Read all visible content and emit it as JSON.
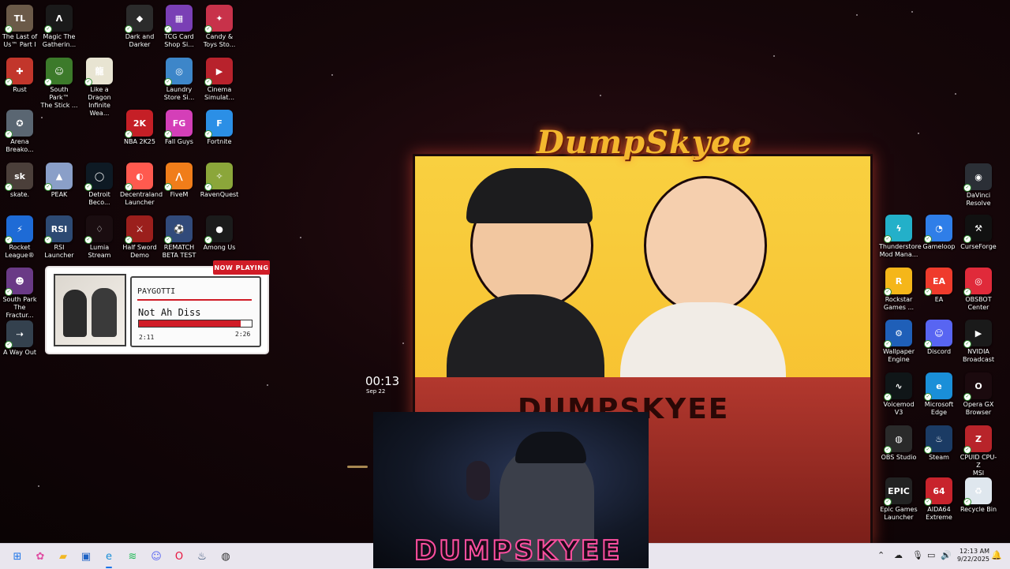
{
  "desktop_icons_left": [
    {
      "label": "The Last of\nUs™ Part I",
      "icon": "last-of-us-icon",
      "color": "#6b5a48",
      "glyph": "TL"
    },
    {
      "label": "Magic The\nGatherin...",
      "icon": "mtg-arena-icon",
      "color": "#1a1a1a",
      "glyph": "Λ"
    },
    {
      "label": "Dark and\nDarker",
      "icon": "dark-and-darker-icon",
      "color": "#2b2b2b",
      "glyph": "◆"
    },
    {
      "label": "TCG Card\nShop Si...",
      "icon": "tcg-card-shop-icon",
      "color": "#7a3fb5",
      "glyph": "▦"
    },
    {
      "label": "Candy &\nToys Sto...",
      "icon": "candy-toys-store-icon",
      "color": "#c8324a",
      "glyph": "✦"
    },
    {
      "label": "Rust",
      "icon": "rust-icon",
      "color": "#c2362b",
      "glyph": "✚"
    },
    {
      "label": "South Park™\nThe Stick ...",
      "icon": "south-park-stick-icon",
      "color": "#3c7a2a",
      "glyph": "☺"
    },
    {
      "label": "Like a Dragon\nInfinite Wea...",
      "icon": "like-a-dragon-icon",
      "color": "#e8e4d2",
      "glyph": "龍"
    },
    {
      "label": "Laundry\nStore Si...",
      "icon": "laundry-store-icon",
      "color": "#3d86c9",
      "glyph": "◎"
    },
    {
      "label": "Cinema\nSimulat...",
      "icon": "cinema-simulator-icon",
      "color": "#b8222c",
      "glyph": "▶"
    },
    {
      "label": "Arena\nBreako...",
      "icon": "arena-breakout-icon",
      "color": "#5a6672",
      "glyph": "✪"
    },
    {
      "label": "NBA 2K25",
      "icon": "nba-2k25-icon",
      "color": "#c51f26",
      "glyph": "2K"
    },
    {
      "label": "Fall Guys",
      "icon": "fall-guys-icon",
      "color": "#d43fb8",
      "glyph": "FG"
    },
    {
      "label": "Fortnite",
      "icon": "fortnite-icon",
      "color": "#2b8fe6",
      "glyph": "F"
    },
    {
      "label": "skate.",
      "icon": "skate-icon",
      "color": "#4b3f3a",
      "glyph": "sk"
    },
    {
      "label": "PEAK",
      "icon": "peak-icon",
      "color": "#8a9fc8",
      "glyph": "▲"
    },
    {
      "label": "Detroit\nBeco...",
      "icon": "detroit-become-human-icon",
      "color": "#0e1a24",
      "glyph": "◯"
    },
    {
      "label": "Decentraland\nLauncher",
      "icon": "decentraland-icon",
      "color": "#ff5a4f",
      "glyph": "◐"
    },
    {
      "label": "FiveM",
      "icon": "fivem-icon",
      "color": "#f07d1a",
      "glyph": "⋀"
    },
    {
      "label": "RavenQuest",
      "icon": "ravenquest-icon",
      "color": "#8ba63a",
      "glyph": "✧"
    },
    {
      "label": "Rocket\nLeague®",
      "icon": "rocket-league-icon",
      "color": "#1e6bd6",
      "glyph": "⚡"
    },
    {
      "label": "RSI Launcher",
      "icon": "rsi-launcher-icon",
      "color": "#2d4a73",
      "glyph": "RSI"
    },
    {
      "label": "Lumia\nStream",
      "icon": "lumia-stream-icon",
      "color": "#1a0d10",
      "glyph": "♢"
    },
    {
      "label": "Half Sword\nDemo",
      "icon": "half-sword-icon",
      "color": "#9b1f1c",
      "glyph": "⚔"
    },
    {
      "label": "REMATCH\nBETA TEST",
      "icon": "rematch-icon",
      "color": "#314a7a",
      "glyph": "⚽"
    },
    {
      "label": "Among Us",
      "icon": "among-us-icon",
      "color": "#1b1b1b",
      "glyph": "●"
    },
    {
      "label": "South Park\nThe Fractur...",
      "icon": "south-park-fractured-icon",
      "color": "#6a3a86",
      "glyph": "☻"
    },
    {
      "label": "A Way Out",
      "icon": "a-way-out-icon",
      "color": "#34414e",
      "glyph": "⇢"
    }
  ],
  "desktop_icons_right": [
    {
      "label": "DaVinci\nResolve",
      "icon": "davinci-resolve-icon",
      "color": "#2b2f36",
      "glyph": "◉"
    },
    {
      "label": "Thunderstore\nMod Mana...",
      "icon": "thunderstore-icon",
      "color": "#23b0c9",
      "glyph": "ϟ"
    },
    {
      "label": "Gameloop",
      "icon": "gameloop-icon",
      "color": "#2f7ee8",
      "glyph": "◔"
    },
    {
      "label": "CurseForge",
      "icon": "curseforge-icon",
      "color": "#111111",
      "glyph": "⚒"
    },
    {
      "label": "Rockstar\nGames ...",
      "icon": "rockstar-icon",
      "color": "#f5b619",
      "glyph": "R"
    },
    {
      "label": "EA",
      "icon": "ea-icon",
      "color": "#ef3b2c",
      "glyph": "EA"
    },
    {
      "label": "OBSBOT\nCenter",
      "icon": "obsbot-icon",
      "color": "#e02a3a",
      "glyph": "◎"
    },
    {
      "label": "Wallpaper\nEngine",
      "icon": "wallpaper-engine-icon",
      "color": "#1f5fb8",
      "glyph": "⚙"
    },
    {
      "label": "Discord",
      "icon": "discord-icon",
      "color": "#5865f2",
      "glyph": "☺"
    },
    {
      "label": "NVIDIA\nBroadcast",
      "icon": "nvidia-broadcast-icon",
      "color": "#1a1a1a",
      "glyph": "▶"
    },
    {
      "label": "Voicemod V3",
      "icon": "voicemod-icon",
      "color": "#101618",
      "glyph": "∿"
    },
    {
      "label": "Microsoft\nEdge",
      "icon": "edge-icon",
      "color": "#1a8fd8",
      "glyph": "e"
    },
    {
      "label": "Opera GX\nBrowser",
      "icon": "opera-gx-icon",
      "color": "#1b0a0e",
      "glyph": "O"
    },
    {
      "label": "OBS Studio",
      "icon": "obs-studio-icon",
      "color": "#2a2a2a",
      "glyph": "◍"
    },
    {
      "label": "Steam",
      "icon": "steam-icon",
      "color": "#1b3b64",
      "glyph": "♨"
    },
    {
      "label": "CPUID CPU-Z\nMSI",
      "icon": "cpu-z-icon",
      "color": "#b8242a",
      "glyph": "Z"
    },
    {
      "label": "Epic Games\nLauncher",
      "icon": "epic-games-icon",
      "color": "#222222",
      "glyph": "EPIC"
    },
    {
      "label": "AIDA64\nExtreme",
      "icon": "aida64-icon",
      "color": "#c8232c",
      "glyph": "64"
    },
    {
      "label": "Recycle Bin",
      "icon": "recycle-bin-icon",
      "color": "#dfe7ee",
      "glyph": "♻"
    }
  ],
  "now_playing": {
    "badge": "NOW PLAYING",
    "artist": "PAYGOTTI",
    "title": "Not Ah Diss",
    "elapsed": "2:11",
    "total": "2:26",
    "progress_fraction": 0.9
  },
  "clock_widget": {
    "time": "00:13",
    "date": "Sep 22"
  },
  "wallpaper": {
    "logo": "DumpSkyee",
    "desk_text": "DUMPSKYEE",
    "webcam_text": "DUMPSKYEE"
  },
  "taskbar": {
    "apps": [
      {
        "name": "start-button",
        "glyph": "⊞",
        "color": "#1a73e8"
      },
      {
        "name": "copilot-button",
        "glyph": "✿",
        "color": "#e04fa3"
      },
      {
        "name": "file-explorer-button",
        "glyph": "▰",
        "color": "#f2b824"
      },
      {
        "name": "store-button",
        "glyph": "▣",
        "color": "#1f63c5"
      },
      {
        "name": "edge-taskbar-button",
        "glyph": "e",
        "color": "#1a8fd8"
      },
      {
        "name": "spotify-button",
        "glyph": "≋",
        "color": "#1db954"
      },
      {
        "name": "discord-taskbar-button",
        "glyph": "☺",
        "color": "#5865f2"
      },
      {
        "name": "opera-gx-taskbar-button",
        "glyph": "O",
        "color": "#e8143e"
      },
      {
        "name": "steam-taskbar-button",
        "glyph": "♨",
        "color": "#1b3b64"
      },
      {
        "name": "obs-taskbar-button",
        "glyph": "◍",
        "color": "#333333"
      }
    ],
    "tray": {
      "time": "12:13 AM",
      "date": "9/22/2025"
    }
  }
}
